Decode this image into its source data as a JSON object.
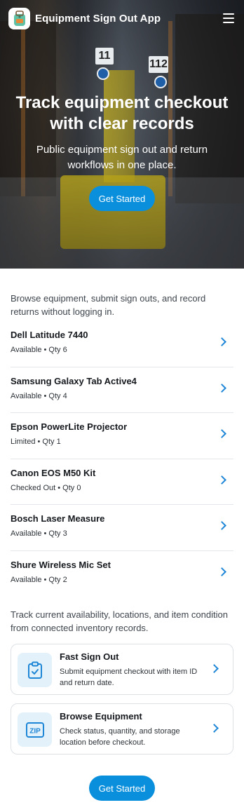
{
  "header": {
    "app_title": "Equipment Sign Out App",
    "logo_icon": "backpack-icon",
    "menu_icon": "hamburger-menu-icon"
  },
  "hero": {
    "title": "Track equipment checkout with clear records",
    "subtitle": "Public equipment sign out and return workflows in one place.",
    "cta_label": "Get Started",
    "sign_labels": [
      "11",
      "112"
    ]
  },
  "intro": "Browse equipment, submit sign outs, and record returns without logging in.",
  "equipment": [
    {
      "name": "Dell Latitude 7440",
      "meta": "Available • Qty 6"
    },
    {
      "name": "Samsung Galaxy Tab Active4",
      "meta": "Available • Qty 4"
    },
    {
      "name": "Epson PowerLite Projector",
      "meta": "Limited • Qty 1"
    },
    {
      "name": "Canon EOS M50 Kit",
      "meta": "Checked Out • Qty 0"
    },
    {
      "name": "Bosch Laser Measure",
      "meta": "Available • Qty 3"
    },
    {
      "name": "Shure Wireless Mic Set",
      "meta": "Available • Qty 2"
    }
  ],
  "intro2": "Track current availability, locations, and item condition from connected inventory records.",
  "features": [
    {
      "title": "Fast Sign Out",
      "desc": "Submit equipment checkout with item ID and return date.",
      "icon": "clipboard-check-icon"
    },
    {
      "title": "Browse Equipment",
      "desc": "Check status, quantity, and storage location before checkout.",
      "icon": "zip-file-icon",
      "icon_text": "ZIP"
    }
  ],
  "footer_cta_label": "Get Started",
  "colors": {
    "accent": "#0a8fdc",
    "chevron": "#1e86d6",
    "icon_bg": "#e3f1fb"
  }
}
